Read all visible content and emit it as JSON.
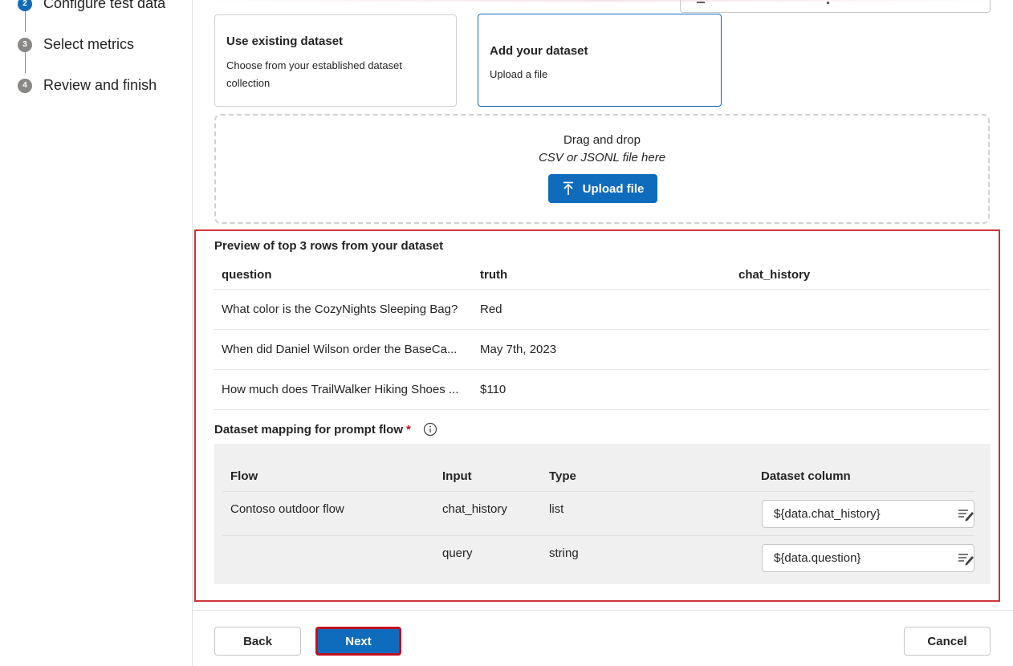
{
  "steps": [
    {
      "number": "2",
      "label": "Configure test data",
      "state": "active"
    },
    {
      "number": "3",
      "label": "Select metrics",
      "state": "pending"
    },
    {
      "number": "4",
      "label": "Review and finish",
      "state": "pending"
    }
  ],
  "data_source_options": [
    {
      "title": "Use existing dataset",
      "description": "Choose from your established dataset collection",
      "selected": false
    },
    {
      "title": "Add your dataset",
      "description": "Upload a file",
      "selected": true
    }
  ],
  "dropzone": {
    "title": "Drag and drop",
    "subtitle": "CSV or JSONL file here",
    "upload_label": "Upload file",
    "upload_icon": "upload-arrow-icon"
  },
  "preview": {
    "title": "Preview of top 3 rows from your dataset",
    "columns": [
      "question",
      "truth",
      "chat_history"
    ],
    "rows": [
      [
        "What color is the CozyNights Sleeping Bag?",
        "Red",
        ""
      ],
      [
        "When did Daniel Wilson order the BaseCa...",
        "May 7th, 2023",
        ""
      ],
      [
        "How much does TrailWalker Hiking Shoes ...",
        "$110",
        ""
      ]
    ]
  },
  "mapping": {
    "title": "Dataset mapping for prompt flow",
    "required_marker": "*",
    "info_icon": "info-icon",
    "headers": [
      "Flow",
      "Input",
      "Type",
      "Dataset column"
    ],
    "rows": [
      {
        "flow": "Contoso outdoor flow",
        "input": "chat_history",
        "type": "list",
        "column": "${data.chat_history}"
      },
      {
        "flow": "",
        "input": "query",
        "type": "string",
        "column": "${data.question}"
      }
    ],
    "column_icon": "edit-mapping-icon"
  },
  "footer": {
    "back_label": "Back",
    "next_label": "Next",
    "cancel_label": "Cancel"
  },
  "colors": {
    "accent": "#0f6cbd",
    "highlight": "#d13438",
    "required": "#c50f1f"
  }
}
